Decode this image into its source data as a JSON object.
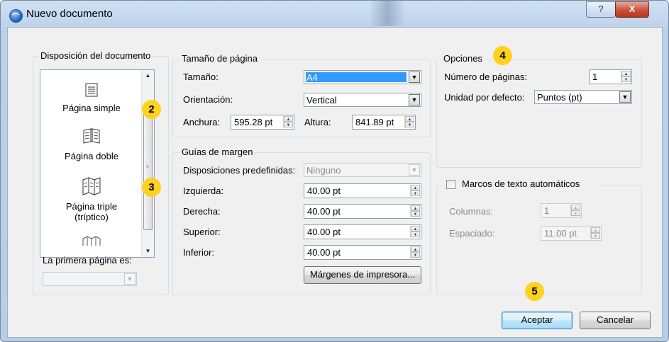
{
  "window": {
    "title": "Nuevo documento",
    "help_label": "?",
    "close_label": "X"
  },
  "layout_group": {
    "title": "Disposición del documento",
    "items": [
      {
        "label": "Página simple"
      },
      {
        "label": "Página doble"
      },
      {
        "label_line1": "Página triple",
        "label_line2": "(tríptico)"
      }
    ],
    "first_page_label": "La primera página es:",
    "first_page_value": ""
  },
  "page_size": {
    "title": "Tamaño de página",
    "size_label": "Tamaño:",
    "size_value": "A4",
    "orientation_label": "Orientación:",
    "orientation_value": "Vertical",
    "width_label": "Anchura:",
    "width_value": "595.28 pt",
    "height_label": "Altura:",
    "height_value": "841.89 pt"
  },
  "margins": {
    "title": "Guías de margen",
    "presets_label": "Disposiciones predefinidas:",
    "presets_value": "Ninguno",
    "left_label": "Izquierda:",
    "left_value": "40.00 pt",
    "right_label": "Derecha:",
    "right_value": "40.00 pt",
    "top_label": "Superior:",
    "top_value": "40.00 pt",
    "bottom_label": "Inferior:",
    "bottom_value": "40.00 pt",
    "printer_margins_button": "Márgenes de impresora..."
  },
  "options": {
    "title": "Opciones",
    "pages_label": "Número de páginas:",
    "pages_value": "1",
    "unit_label": "Unidad por defecto:",
    "unit_value": "Puntos (pt)"
  },
  "autoframes": {
    "checkbox_label": "Marcos de texto automáticos",
    "checked": false,
    "columns_label": "Columnas:",
    "columns_value": "1",
    "spacing_label": "Espaciado:",
    "spacing_value": "11.00 pt"
  },
  "buttons": {
    "ok": "Aceptar",
    "cancel": "Cancelar"
  },
  "callouts": [
    "2",
    "3",
    "4",
    "5"
  ],
  "colors": {
    "callout": "#ffd21f",
    "selection": "#3399ff"
  }
}
